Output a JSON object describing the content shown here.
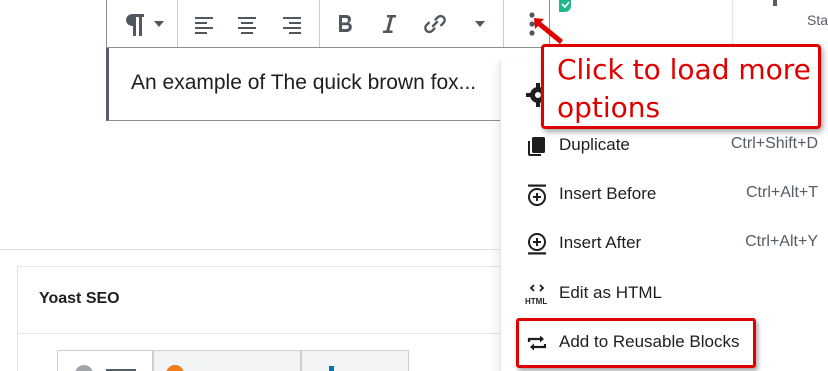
{
  "toolbar": {
    "paragraph_icon": "pilcrow-icon",
    "buttons": [
      "paragraph-type",
      "align-left",
      "align-center",
      "align-right",
      "bold",
      "italic",
      "link",
      "more-formatting",
      "more-options"
    ]
  },
  "block": {
    "text": "An example of The quick brown fox..."
  },
  "sidebar": {
    "fragment": "Sta"
  },
  "yoast": {
    "title": "Yoast SEO"
  },
  "menu": {
    "items": [
      {
        "label": "Duplicate",
        "shortcut": "Ctrl+Shift+D",
        "icon": "duplicate-icon"
      },
      {
        "label": "Insert Before",
        "shortcut": "Ctrl+Alt+T",
        "icon": "insert-before-icon"
      },
      {
        "label": "Insert After",
        "shortcut": "Ctrl+Alt+Y",
        "icon": "insert-after-icon"
      },
      {
        "label": "Edit as HTML",
        "shortcut": "",
        "icon": "html-icon"
      },
      {
        "label": "Add to Reusable Blocks",
        "shortcut": "",
        "icon": "reusable-blocks-icon"
      }
    ]
  },
  "annotation": {
    "callout_line1": "Click to load more",
    "callout_line2": "options"
  },
  "colors": {
    "highlight": "#e00000",
    "accent_teal": "#1fb68c"
  }
}
